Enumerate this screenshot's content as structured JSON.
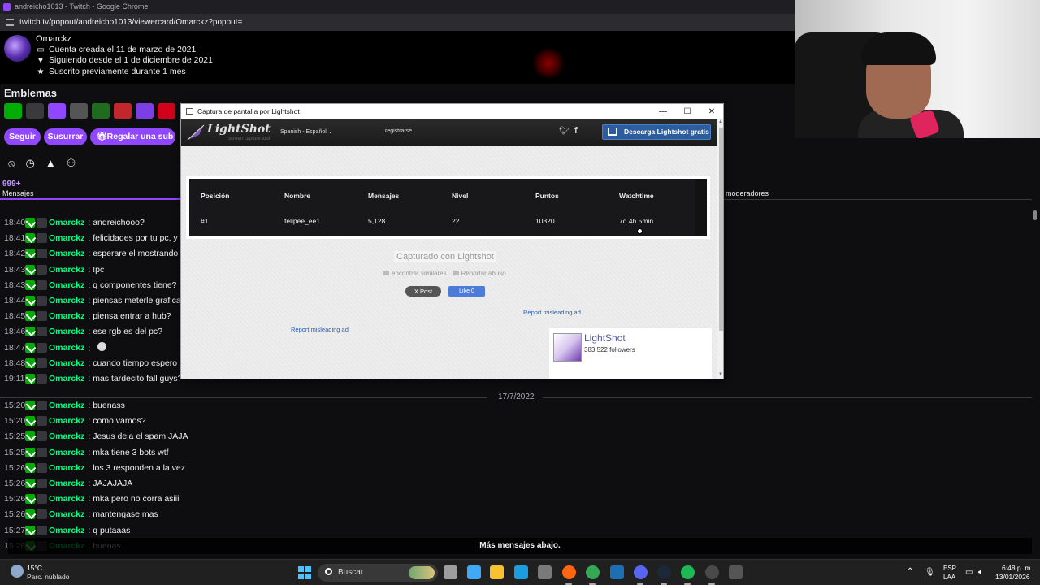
{
  "browser": {
    "title": "andreicho1013 - Twitch - Google Chrome",
    "url": "twitch.tv/popout/andreicho1013/viewercard/Omarckz?popout="
  },
  "viewercard": {
    "username": "Omarckz",
    "created": "Cuenta creada el 11 de marzo de 2021",
    "following": "Siguiendo desde el 1 de diciembre de 2021",
    "subscribed": "Suscrito previamente durante 1 mes"
  },
  "emblemas": {
    "title": "Emblemas",
    "badge_colors": [
      "#00ad03",
      "#3a3a3d",
      "#9147ff",
      "#555555",
      "#1f6b1f",
      "#c1272d",
      "#7b3fe4",
      "#d0021b",
      "#c43c8b",
      "#3a3a3d"
    ]
  },
  "actions": {
    "follow": "Seguir",
    "whisper": "Susurrar",
    "gift": "Regalar una sub"
  },
  "tabs": {
    "count": "999+",
    "messages": "Mensajes",
    "moderators": "moderadores"
  },
  "chat": {
    "username": "Omarckz",
    "messages_before": [
      {
        "time": "18:40",
        "text": "andreichooo?"
      },
      {
        "time": "18:41",
        "text": "felicidades por tu pc, y por"
      },
      {
        "time": "18:42",
        "text": "esperare el mostrando tu s"
      },
      {
        "time": "18:43",
        "text": "!pc"
      },
      {
        "time": "18:43",
        "text": "q componentes tiene?"
      },
      {
        "time": "18:44",
        "text": "piensas meterle grafica?"
      },
      {
        "time": "18:45",
        "text": "piensa entrar a hub?"
      },
      {
        "time": "18:46",
        "text": "ese rgb es del pc?"
      },
      {
        "time": "18:47",
        "text": ""
      },
      {
        "time": "18:48",
        "text": "cuando tiempo espero pa"
      },
      {
        "time": "19:11",
        "text": "mas tardecito fall guys?"
      }
    ],
    "date_separator": "17/7/2022",
    "messages_after": [
      {
        "time": "15:20",
        "text": "buenass"
      },
      {
        "time": "15:20",
        "text": "como vamos?"
      },
      {
        "time": "15:25",
        "text": "Jesus deja el spam JAJA"
      },
      {
        "time": "15:25",
        "text": "mka tiene 3 bots wtf"
      },
      {
        "time": "15:26",
        "text": "los 3 responden a la vez"
      },
      {
        "time": "15:26",
        "text": "JAJAJAJA"
      },
      {
        "time": "15:26",
        "text": "mka pero no corra asiiii"
      },
      {
        "time": "15:26",
        "text": "mantengase mas"
      },
      {
        "time": "15:27",
        "text": "q putaaas"
      },
      {
        "time": "15:28",
        "text": "buenas"
      }
    ],
    "more_below": "Más mensajes abajo."
  },
  "lightshot": {
    "window_title": "Captura de pantalla por Lightshot",
    "brand": "LightShot",
    "tagline": "screen capture tool",
    "language": "Spanish - Español",
    "register": "registrarse",
    "download": "Descarga Lightshot gratis",
    "table": {
      "headers": [
        "Posición",
        "Nombre",
        "Mensajes",
        "Nivel",
        "Puntos",
        "Watchtime"
      ],
      "row": [
        "#1",
        "felipee_ee1",
        "5,128",
        "22",
        "10320",
        "7d 4h 5min"
      ]
    },
    "captured": "Capturado con Lightshot",
    "find_similar": "encontrar similares",
    "report_abuse": "Reportar abuso",
    "post": "X Post",
    "like": "Like 0",
    "report_ad": "Report misleading ad",
    "follow_name": "LightShot",
    "follow_count": "383,522 followers"
  },
  "taskbar": {
    "temp": "15°C",
    "weather": "Parc. nublado",
    "search": "Buscar",
    "lang_top": "ESP",
    "lang_bottom": "LAA",
    "time": "6:48 p. m.",
    "date": "13/01/2026",
    "app_colors": [
      "#9e9e9e",
      "#3fa9f5",
      "#f7c12f",
      "#1b9de2",
      "#7a7a7a",
      "#ff6611",
      "#34a853",
      "#1c6fb5",
      "#5865f2",
      "#1b2838",
      "#1db954",
      "#4a4a4a",
      "#555555"
    ]
  }
}
